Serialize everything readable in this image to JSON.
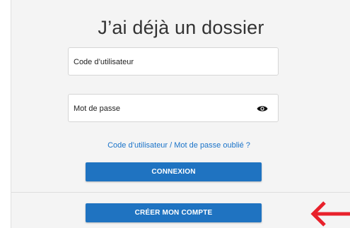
{
  "login": {
    "title": "J’ai déjà un dossier",
    "username_label": "Code d’utilisateur",
    "password_label": "Mot de passe",
    "forgot_link": "Code d’utilisateur / Mot de passe oublié ?",
    "login_button": "CONNEXION",
    "create_button": "CRÉER MON COMPTE"
  },
  "icons": {
    "password_toggle": "eye-icon",
    "pointer_arrow": "left-arrow-icon"
  },
  "colors": {
    "primary_button": "#1f73c1",
    "link": "#1a73c9",
    "arrow": "#e8212b",
    "card_background": "#f4f4f4"
  }
}
